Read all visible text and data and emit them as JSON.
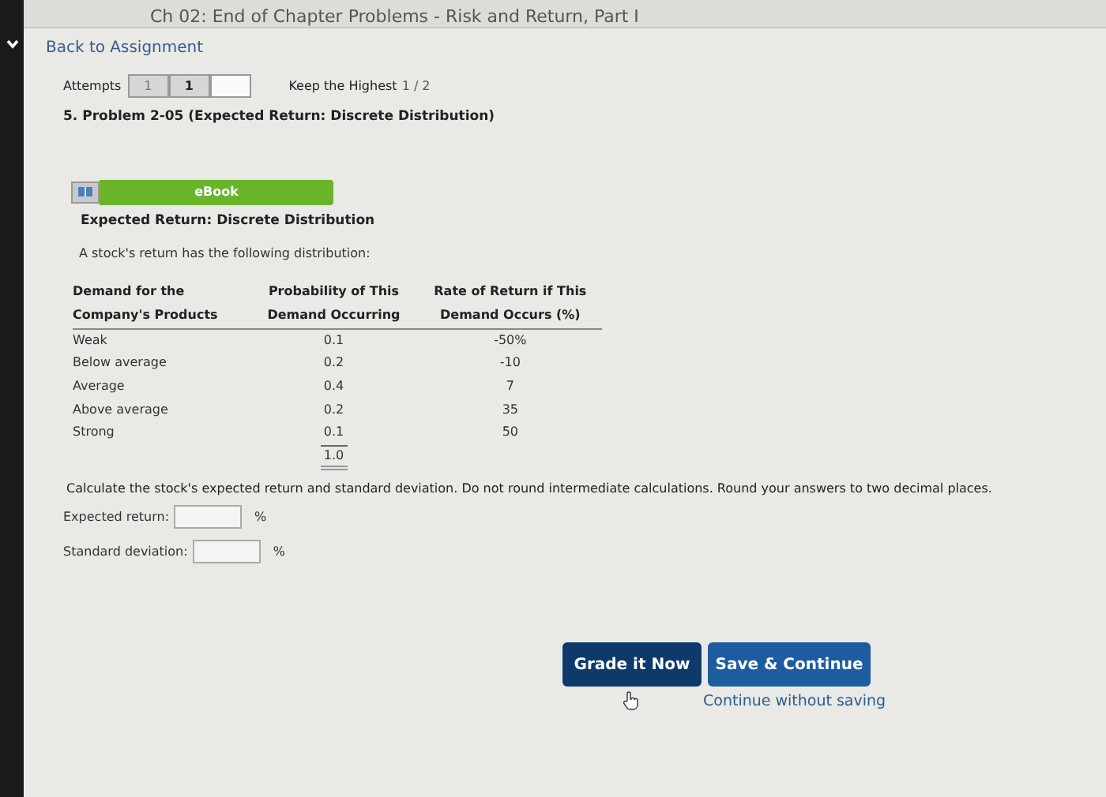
{
  "header": {
    "title": "Ch 02: End of Chapter Problems - Risk and Return, Part I"
  },
  "back_link": "Back to Assignment",
  "attempts": {
    "label": "Attempts",
    "boxes": [
      {
        "value": "1",
        "filled": true
      },
      {
        "value": "1",
        "filled": true
      },
      {
        "filled": false
      }
    ],
    "keep_label": "Keep the Highest",
    "keep_value": "1 / 2"
  },
  "problem_title": "5. Problem 2-05 (Expected Return: Discrete Distribution)",
  "ebook_button": "eBook",
  "section_title": "Expected Return: Discrete Distribution",
  "intro": "A stock's return has the following distribution:",
  "table": {
    "columns": [
      "Demand for the Company's Products",
      "Probability of This Demand Occurring",
      "Rate of Return if This Demand Occurs (%)"
    ],
    "rows": [
      [
        "Weak",
        "0.1",
        "-50%"
      ],
      [
        "Below average",
        "0.2",
        "-10"
      ],
      [
        "Average",
        "0.4",
        "7"
      ],
      [
        "Above average",
        "0.2",
        "35"
      ],
      [
        "Strong",
        "0.1",
        "50"
      ]
    ],
    "total": "1.0"
  },
  "instructions": "Calculate the stock's expected return and standard deviation. Do not round intermediate calculations. Round your answers to two decimal places.",
  "fields": [
    {
      "label": "Expected return:",
      "unit": "%"
    },
    {
      "label": "Standard deviation:",
      "unit": "%"
    }
  ],
  "buttons": [
    {
      "label": "Grade it Now",
      "kind": "dark"
    },
    {
      "label": "Save & Continue",
      "kind": "primary"
    }
  ],
  "continue_link": "Continue without saving"
}
